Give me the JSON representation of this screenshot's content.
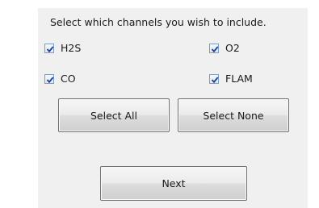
{
  "dialog": {
    "instruction": "Select which channels you wish to include."
  },
  "channels": [
    {
      "label": "H2S",
      "checked": true
    },
    {
      "label": "O2",
      "checked": true
    },
    {
      "label": "CO",
      "checked": true
    },
    {
      "label": "FLAM",
      "checked": true
    }
  ],
  "buttons": {
    "select_all": "Select All",
    "select_none": "Select None",
    "next": "Next"
  },
  "colors": {
    "panel_background": "#f0f0f0",
    "checkmark": "#1c3f95",
    "checkbox_border": "#7f9db9"
  },
  "icons": {
    "checkbox_checked": "checkmark-icon"
  }
}
